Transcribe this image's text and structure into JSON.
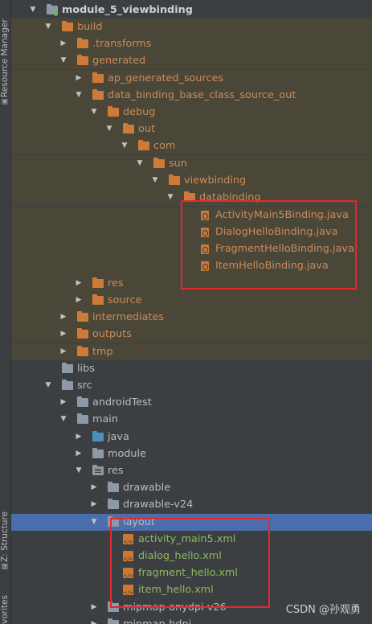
{
  "side_panel": {
    "resource_manager": "Resource Manager",
    "structure": "Z: Structure",
    "favorites": "vorites"
  },
  "tree": [
    {
      "label": "module_5_viewbinding",
      "arrow": "down"
    },
    {
      "label": "build",
      "arrow": "down"
    },
    {
      "label": ".transforms",
      "arrow": "right"
    },
    {
      "label": "generated",
      "arrow": "down"
    },
    {
      "label": "ap_generated_sources",
      "arrow": "right"
    },
    {
      "label": "data_binding_base_class_source_out",
      "arrow": "down"
    },
    {
      "label": "debug",
      "arrow": "down"
    },
    {
      "label": "out",
      "arrow": "down"
    },
    {
      "label": "com",
      "arrow": "down"
    },
    {
      "label": "sun",
      "arrow": "down"
    },
    {
      "label": "viewbinding",
      "arrow": "down"
    },
    {
      "label": "databinding",
      "arrow": "down"
    },
    {
      "label": "ActivityMain5Binding.java"
    },
    {
      "label": "DialogHelloBinding.java"
    },
    {
      "label": "FragmentHelloBinding.java"
    },
    {
      "label": "ItemHelloBinding.java"
    },
    {
      "label": "res",
      "arrow": "right"
    },
    {
      "label": "source",
      "arrow": "right"
    },
    {
      "label": "intermediates",
      "arrow": "right"
    },
    {
      "label": "outputs",
      "arrow": "right"
    },
    {
      "label": "tmp",
      "arrow": "right"
    },
    {
      "label": "libs"
    },
    {
      "label": "src",
      "arrow": "down"
    },
    {
      "label": "androidTest",
      "arrow": "right"
    },
    {
      "label": "main",
      "arrow": "down"
    },
    {
      "label": "java",
      "arrow": "right"
    },
    {
      "label": "module",
      "arrow": "right"
    },
    {
      "label": "res",
      "arrow": "down"
    },
    {
      "label": "drawable",
      "arrow": "right"
    },
    {
      "label": "drawable-v24",
      "arrow": "right"
    },
    {
      "label": "layout",
      "arrow": "down"
    },
    {
      "label": "activity_main5.xml"
    },
    {
      "label": "dialog_hello.xml"
    },
    {
      "label": "fragment_hello.xml"
    },
    {
      "label": "item_hello.xml"
    },
    {
      "label": "mipmap-anydpi-v26",
      "arrow": "right"
    },
    {
      "label": "mipmap-hdpi",
      "arrow": "right"
    }
  ],
  "watermark": "CSDN @孙观勇",
  "colors": {
    "background": "#3c3f41",
    "build_highlight": "#4a4739",
    "selection": "#4b6eaf",
    "annotation_box": "#e8262d",
    "generated_text": "#cc8b57",
    "file_text": "#8fb75f"
  }
}
